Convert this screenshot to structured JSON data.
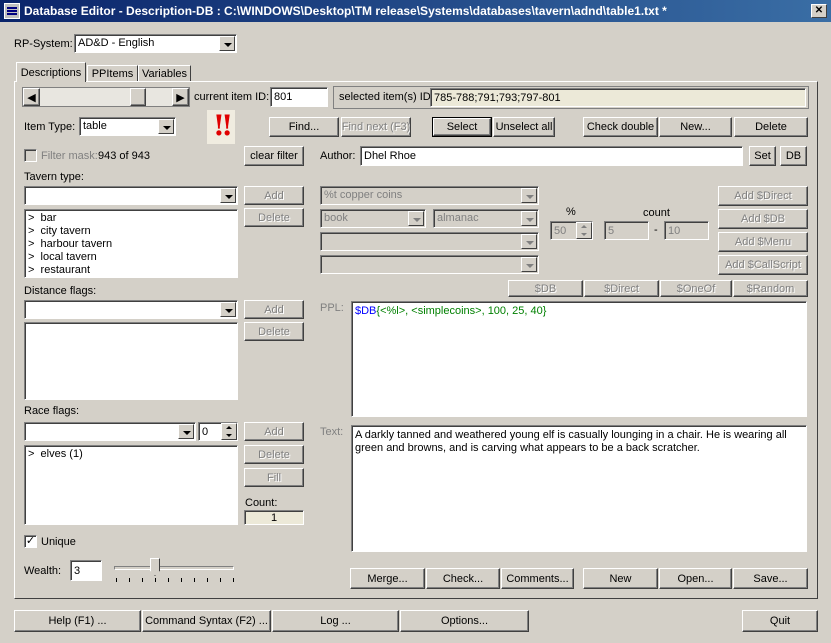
{
  "window": {
    "title": "Database Editor - Description-DB : C:\\WINDOWS\\Desktop\\TM release\\Systems\\databases\\tavern\\adnd\\table1.txt *"
  },
  "rp_system": {
    "label": "RP-System:",
    "value": "AD&D - English"
  },
  "tabs": [
    {
      "label": "Descriptions"
    },
    {
      "label": "PPItems"
    },
    {
      "label": "Variables"
    }
  ],
  "nav": {
    "current_label": "current item ID:",
    "current_value": "801",
    "selected_label": "selected item(s) ID:",
    "selected_value": "785-788;791;793;797-801",
    "slider_position": 0.78
  },
  "item_type": {
    "label": "Item Type:",
    "value": "table"
  },
  "toolbar": {
    "find": "Find...",
    "find_next": "Find next (F3)",
    "select": "Select",
    "unselect_all": "Unselect all",
    "check_double": "Check double",
    "new": "New...",
    "delete": "Delete"
  },
  "filter": {
    "label": "Filter mask:",
    "count": "943 of 943",
    "clear_button": "clear filter",
    "checked": false
  },
  "author": {
    "label": "Author:",
    "value": "Dhel Rhoe",
    "set_button": "Set",
    "db_button": "DB"
  },
  "tavern_type": {
    "label": "Tavern type:",
    "combo_value": "",
    "add": "Add",
    "delete": "Delete",
    "items": [
      "bar",
      "city tavern",
      "harbour tavern",
      "local tavern",
      "restaurant"
    ]
  },
  "distance_flags": {
    "label": "Distance flags:",
    "combo_value": "",
    "add": "Add",
    "delete": "Delete"
  },
  "race_flags": {
    "label": "Race flags:",
    "combo_value": "",
    "spin_value": "0",
    "add": "Add",
    "delete": "Delete",
    "fill": "Fill",
    "count_label": "Count:",
    "count_value": "1",
    "items": [
      "elves (1)"
    ]
  },
  "unique": {
    "label": "Unique",
    "checked": true
  },
  "wealth": {
    "label": "Wealth:",
    "value": "3",
    "slider_position": 0.33
  },
  "generator": {
    "combo1": "%t copper coins",
    "combo2": "book",
    "combo3": "almanac",
    "combo4": "",
    "combo5": "",
    "percent_label": "%",
    "percent_value": "50",
    "count_label": "count",
    "count_min": "5",
    "count_dash": "-",
    "count_max": "10",
    "add_direct": "Add $Direct",
    "add_db": "Add $DB",
    "add_menu": "Add $Menu",
    "add_callscript": "Add $CallScript"
  },
  "macro_buttons": [
    "$DB",
    "$Direct",
    "$OneOf",
    "$Random"
  ],
  "ppl": {
    "label": "PPL:",
    "tokens": [
      {
        "text": "$DB",
        "color": "#0000ff"
      },
      {
        "text": "{<%l>, <simplecoins>, 100, 25, 40}",
        "color": "#008000"
      }
    ]
  },
  "text": {
    "label": "Text:",
    "value": "A darkly tanned and weathered young elf is casually lounging in a chair. He is wearing all green and browns, and is carving what appears to be a back scratcher."
  },
  "bottom_actions": {
    "merge": "Merge...",
    "check": "Check...",
    "comments": "Comments...",
    "new": "New",
    "open": "Open...",
    "save": "Save..."
  },
  "footer": {
    "help": "Help (F1) ...",
    "syntax": "Command Syntax (F2) ...",
    "log": "Log ...",
    "options": "Options...",
    "quit": "Quit"
  },
  "colors": {
    "title_start": "#0a246a",
    "title_end": "#3a6ea5",
    "face": "#d4d0c8",
    "alert": "#e00000"
  }
}
